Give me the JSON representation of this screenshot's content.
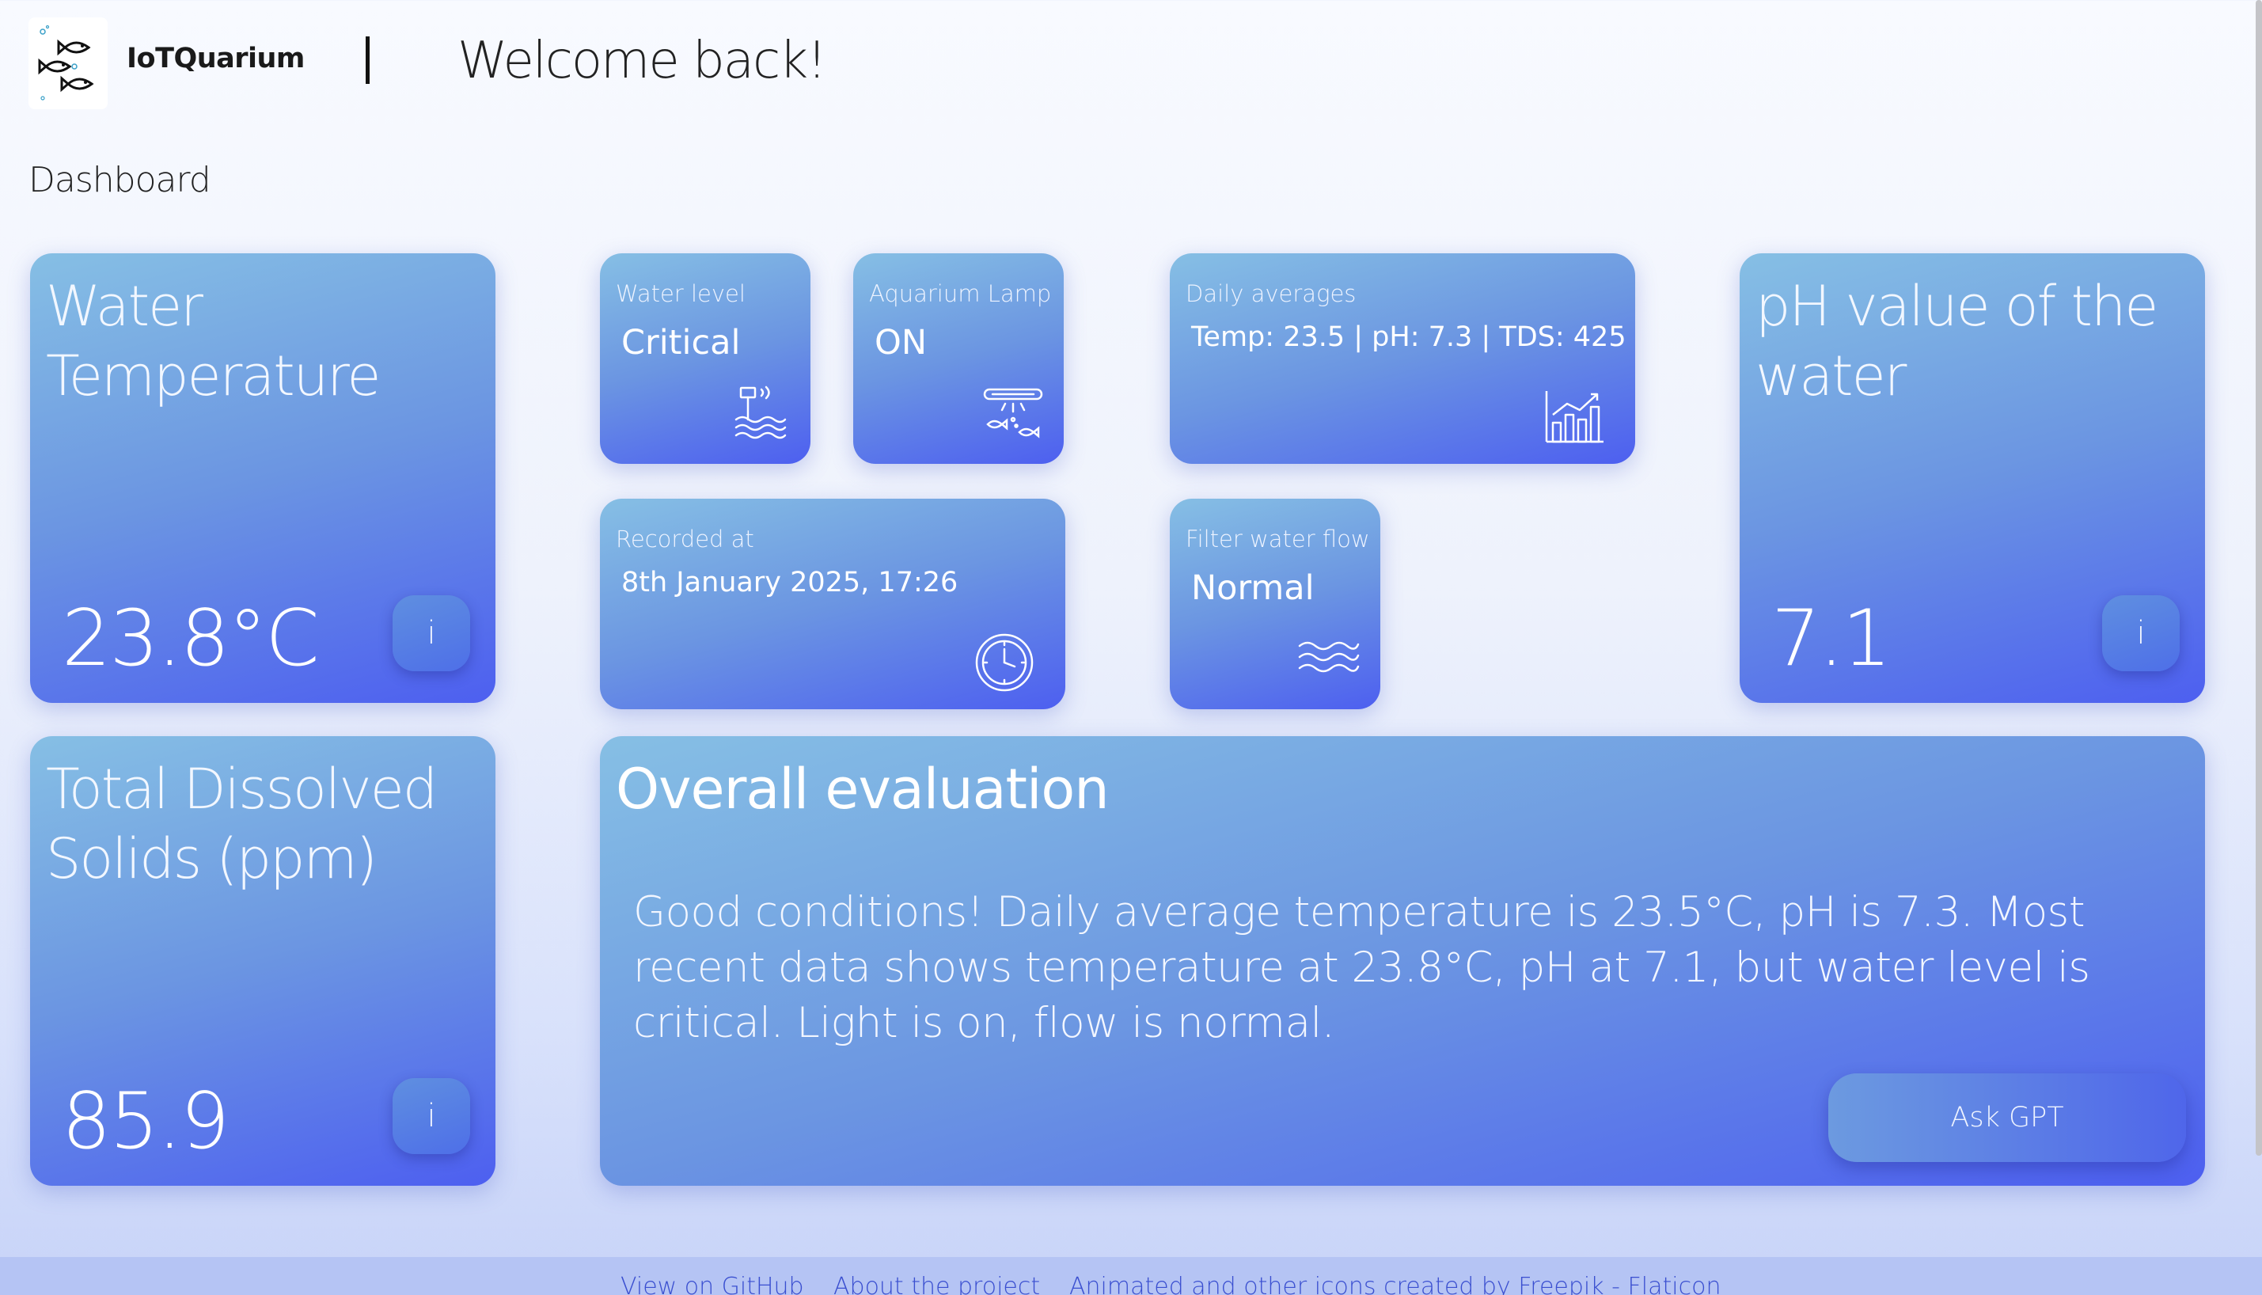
{
  "header": {
    "brand": "IoTQuarium",
    "welcome": "Welcome back!",
    "logo_icon": "fish-logo-icon"
  },
  "section_title": "Dashboard",
  "cards": {
    "water_temperature": {
      "title": "Water Temperature",
      "value": "23.8°C",
      "info_label": "i"
    },
    "ph": {
      "title": "pH value of the water",
      "value": "7.1",
      "info_label": "i"
    },
    "tds": {
      "title": "Total Dissolved Solids (ppm)",
      "value": "85.9",
      "info_label": "i"
    },
    "water_level": {
      "label": "Water level",
      "value": "Critical",
      "icon": "water-level-sensor-icon"
    },
    "aquarium_lamp": {
      "label": "Aquarium Lamp",
      "value": "ON",
      "icon": "aquarium-lamp-icon"
    },
    "daily_averages": {
      "label": "Daily averages",
      "value": "Temp: 23.5 | pH: 7.3 | TDS: 425",
      "icon": "bar-chart-icon"
    },
    "recorded_at": {
      "label": "Recorded at",
      "value": "8th January 2025, 17:26",
      "icon": "clock-icon"
    },
    "filter_flow": {
      "label": "Filter water flow",
      "value": "Normal",
      "icon": "water-waves-icon"
    }
  },
  "evaluation": {
    "title": "Overall evaluation",
    "text": "Good conditions! Daily average temperature is 23.5°C, pH is 7.3. Most recent data shows temperature at 23.8°C, pH at 7.1, but water level is critical. Light is on, flow is normal.",
    "button_label": "Ask GPT"
  },
  "footer": {
    "links": [
      "View on GitHub",
      "About the project",
      "Animated and other icons created by Freepik - Flaticon"
    ]
  },
  "colors": {
    "card_gradient_start": "#86bfe4",
    "card_gradient_end": "#4d5ff0",
    "footer_link": "#3a4fd0"
  }
}
